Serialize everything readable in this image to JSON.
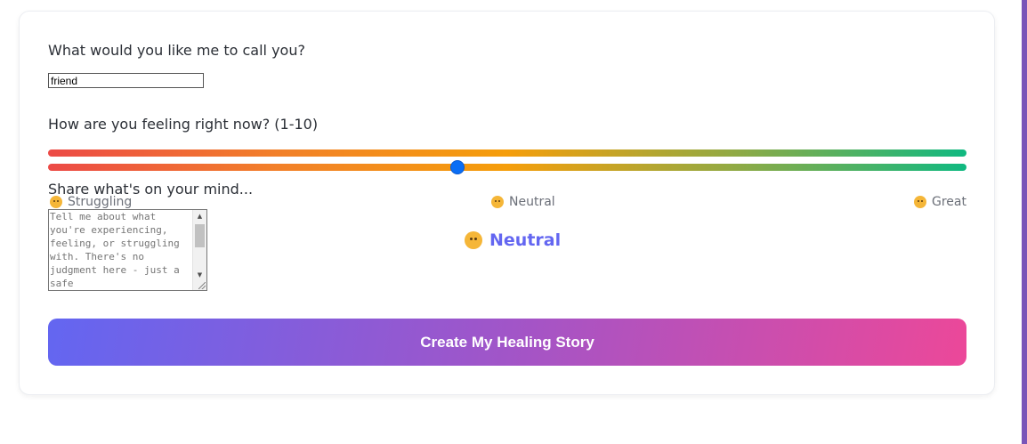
{
  "form": {
    "name_question": "What would you like me to call you?",
    "name_value": "friend",
    "feeling_question": "How are you feeling right now? (1-10)",
    "feeling_value": 5,
    "feeling_min": 1,
    "feeling_max": 10,
    "mood_labels": {
      "low": "Struggling",
      "mid": "Neutral",
      "high": "Great"
    },
    "current_mood": "Neutral",
    "mind_question": "Share what's on your mind...",
    "mind_placeholder": "Tell me about what you're experiencing, feeling, or struggling with. There's no judgment here - just a safe",
    "submit_label": "Create My Healing Story"
  },
  "colors": {
    "accent": "#6366f1",
    "gradient_start": "#6366f1",
    "gradient_end": "#ec4899",
    "slider_low": "#ec4a46",
    "slider_mid": "#f59e0b",
    "slider_high": "#10b981",
    "thumb": "#0a6ef5"
  },
  "icons": {
    "low": "sad-face-icon",
    "mid": "neutral-face-icon",
    "high": "smiling-face-icon"
  }
}
